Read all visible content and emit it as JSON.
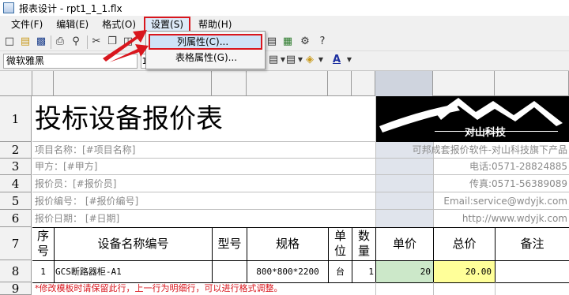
{
  "window": {
    "title": "报表设计 - rpt1_1_1.flx"
  },
  "menu": [
    {
      "label": "文件(F)"
    },
    {
      "label": "编辑(E)"
    },
    {
      "label": "格式(O)"
    },
    {
      "label": "设置(S)"
    },
    {
      "label": "帮助(H)"
    }
  ],
  "settings_menu": {
    "column_props": "列属性(C)...",
    "table_props": "表格属性(G)..."
  },
  "toolbar": {
    "font_name": "微软雅黑",
    "font_size": "1"
  },
  "row_headers": [
    "1",
    "2",
    "3",
    "4",
    "5",
    "6",
    "7",
    "8",
    "9"
  ],
  "report": {
    "title": "投标设备报价表",
    "project_name": "项目名称：[#项目名称]",
    "party_a": "甲方：[#甲方]",
    "quoter": "报价员：[#报价员]",
    "quote_no": "报价编号： [#报价编号]",
    "quote_date": "报价日期：  [#日期]",
    "right_lines": [
      "可邦成套报价软件-对山科技旗下产品",
      "电话:0571-28824885",
      "传真:0571-56389089",
      "Email:service@wdyjk.com",
      "http://www.wdyjk.com"
    ],
    "logo_text": "对山科技",
    "table_headers": {
      "seq": [
        "序",
        "号"
      ],
      "name": "设备名称编号",
      "model": "型号",
      "spec": "规格",
      "unit": [
        "单",
        "位"
      ],
      "qty": [
        "数",
        "量"
      ],
      "unit_price": "单价",
      "total": "总价",
      "remark": "备注"
    },
    "row": {
      "seq": "1",
      "name": "GCS断路器柜-A1",
      "model": "",
      "spec": "800*800*2200",
      "unit": "台",
      "qty": "1",
      "unit_price": "20",
      "total": "20.00",
      "remark": ""
    },
    "note": "*修改模板时请保留此行，上一行为明细行，可以进行格式调整。"
  },
  "colors": {
    "highlight_red": "#d9161d",
    "price_green": "#cce8c9",
    "total_yellow": "#ffff99",
    "col_shade": "#e0e4ec"
  }
}
